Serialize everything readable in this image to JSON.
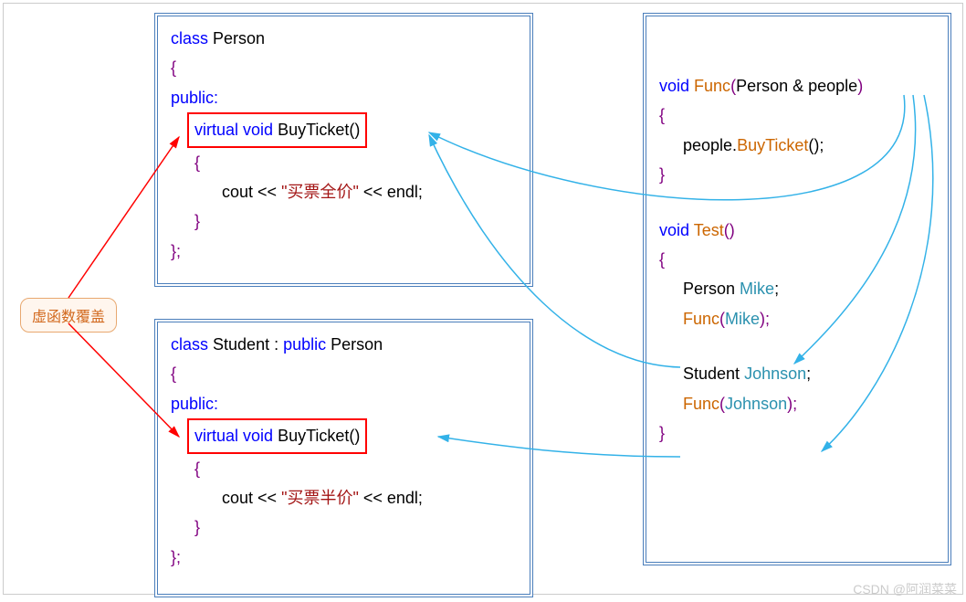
{
  "callout": {
    "label": "虚函数覆盖"
  },
  "person": {
    "decl_class": "class",
    "decl_name": "Person",
    "open": "{",
    "public": "public:",
    "method_virtual": "virtual void",
    "method_name": "BuyTicket()",
    "body_open": "{",
    "body_line_pre": "cout << ",
    "body_string": "\"买票全价\"",
    "body_line_post": " << endl;",
    "body_close": "}",
    "close": "};"
  },
  "student": {
    "decl_prefix": "class",
    "decl_name": "Student",
    "decl_sep": " : ",
    "decl_public": "public",
    "decl_base": " Person",
    "open": "{",
    "public": "public:",
    "method_virtual": "virtual void",
    "method_name": "BuyTicket()",
    "body_open": "{",
    "body_line_pre": "cout << ",
    "body_string": "\"买票半价\"",
    "body_line_post": " << endl;",
    "body_close": "}",
    "close": "};"
  },
  "func": {
    "func1_void": "void",
    "func1_name": " Func",
    "func1_sig_open": "(",
    "func1_param_type": "Person",
    "func1_param_amp": " & ",
    "func1_param_name": "people",
    "func1_sig_close": ")",
    "func1_open": "{",
    "func1_body_pre": "people.",
    "func1_body_call": "BuyTicket",
    "func1_body_post": "();",
    "func1_close": "}",
    "func2_void": "void",
    "func2_name": " Test",
    "func2_sig": "()",
    "func2_open": "{",
    "decl1_type": "Person ",
    "decl1_name": "Mike",
    "decl1_end": ";",
    "call1_fn": "Func",
    "call1_open": "(",
    "call1_arg": "Mike",
    "call1_close": ");",
    "decl2_type": "Student ",
    "decl2_name": "Johnson",
    "decl2_end": ";",
    "call2_fn": "Func",
    "call2_open": "(",
    "call2_arg": "Johnson",
    "call2_close": ");",
    "func2_close": "}"
  },
  "watermark": "CSDN @阿润菜菜"
}
